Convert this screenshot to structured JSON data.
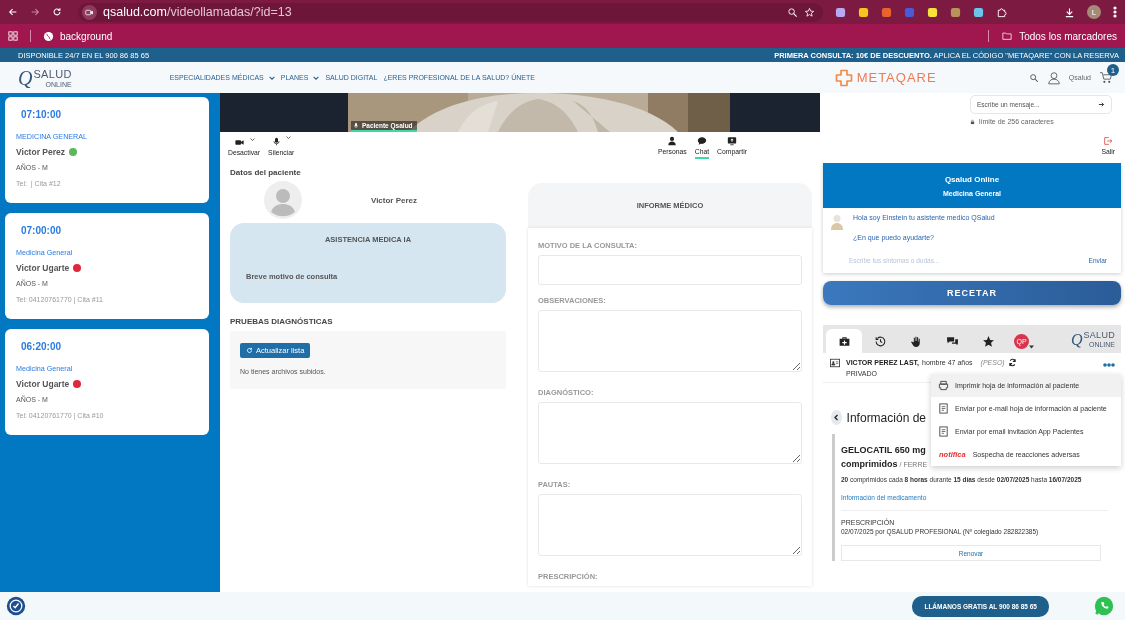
{
  "browser": {
    "url_host": "qsalud.com",
    "url_path": "/videollamadas/?id=13",
    "profile_initial": "L",
    "bookmark": "background",
    "all_bookmarks": "Todos los marcadores"
  },
  "promo": {
    "left": "DISPONIBLE 24/7 EN EL 900 86 85 65",
    "right": "**PRIMERA CONSULTA: 10€ DE DESCUENTO.** APLICA EL CÓDIGO \"METAQARE\" CON LA RESERVA"
  },
  "header": {
    "logo": {
      "mark": "Q",
      "name": "SALUD",
      "sub": "ONLINE"
    },
    "nav": [
      {
        "label": "ESPECIALIDADES MÉDICAS",
        "dropdown": true
      },
      {
        "label": "PLANES",
        "dropdown": true
      },
      {
        "label": "SALUD DIGITAL",
        "dropdown": false
      },
      {
        "label": "¿ERES PROFESIONAL DE LA SALUD? ÚNETE",
        "dropdown": false
      }
    ],
    "brand": "METAQARE",
    "user": "Qsalud",
    "cart_count": "1"
  },
  "appointments": [
    {
      "time": "07:10:00",
      "specialty": "MEDICINA GENERAL",
      "patient": "Victor Perez",
      "color": "#5cb85c",
      "age": "AÑOS - M",
      "contact": "Tel:  | Cita #12"
    },
    {
      "time": "07:00:00",
      "specialty": "Medicina General",
      "patient": "Victor Ugarte",
      "color": "#e0283c",
      "age": "AÑOS - M",
      "contact": "Tel: 04120761770 | Cita #11"
    },
    {
      "time": "06:20:00",
      "specialty": "Medicina General",
      "patient": "Victor Ugarte",
      "color": "#e0283c",
      "age": "AÑOS - M",
      "contact": "Tel: 04120761770 | Cita #10"
    }
  ],
  "video": {
    "participant": "Paciente Qsalud"
  },
  "message": {
    "placeholder": "Escribe un mensaje...",
    "limit": "límite de 256 caracteres"
  },
  "controls": [
    {
      "label": "Desactivar",
      "kind": "camera"
    },
    {
      "label": "Silenciar",
      "kind": "mic"
    }
  ],
  "views": [
    {
      "label": "Personas",
      "kind": "people",
      "selected": false
    },
    {
      "label": "Chat",
      "kind": "chat",
      "selected": true
    },
    {
      "label": "Compartir",
      "kind": "share",
      "selected": false
    }
  ],
  "exit": "Salir",
  "patient": {
    "heading": "Datos del paciente",
    "name": "Victor Perez"
  },
  "ai": {
    "title": "ASISTENCIA MEDICA IA",
    "reason": "Breve motivo de consulta"
  },
  "tests": {
    "heading": "PRUEBAS DIAGNÓSTICAS",
    "button": "Actualizar lista",
    "empty": "No tienes archivos subidos."
  },
  "report": {
    "title": "INFORME MÉDICO",
    "fields": [
      {
        "label": "MOTIVO DE LA CONSULTA:",
        "kind": "line"
      },
      {
        "label": "OBSERVACIONES:",
        "kind": "area"
      },
      {
        "label": "DIAGNÓSTICO:",
        "kind": "area"
      },
      {
        "label": "PAUTAS:",
        "kind": "area"
      },
      {
        "label": "PRESCRIPCIÓN:",
        "kind": "label"
      }
    ]
  },
  "assistant": {
    "title": "Qsalud Online",
    "subtitle": "Medicina General",
    "messages": [
      "Hola soy Einstein tu asistente medico QSalud",
      "¿En que puedo ayudarte?"
    ],
    "placeholder": "Escribe tus sintomas o dudas...",
    "send": "Enviar"
  },
  "prescribe": "RECETAR",
  "rx": {
    "tabs": [
      {
        "kind": "medkit",
        "selected": true
      },
      {
        "kind": "history",
        "selected": false
      },
      {
        "kind": "hand",
        "selected": false
      },
      {
        "kind": "chat",
        "selected": false
      },
      {
        "kind": "star",
        "selected": false
      },
      {
        "kind": "qp",
        "selected": false
      }
    ],
    "qp": "QP",
    "logo": {
      "mark": "Q",
      "name": "SALUD",
      "sub": "ONLINE"
    },
    "patient_name": "VICTOR PEREZ LAST,",
    "patient_info": "hombre 47 años",
    "weight": "(PESO)",
    "coverage": "PRIVADO",
    "section": "Información de",
    "drug_name": "GELOCATIL 650 mg",
    "drug_form": "comprimidos",
    "drug_lab": "/ FERRE",
    "dosage": "**20** comprimidos cada **8 horas** durante **15 días** desde **02/07/2025** hasta **16/07/2025**",
    "drug_link": "Información del medicamento",
    "rx_label": "PRESCRIPCIÓN",
    "rx_detail": "02/07/2025 por QSALUD PROFESIONAL (Nº colegiado 282822385)",
    "renew": "Renovar"
  },
  "menu": [
    {
      "label": "Imprimir hoja de información al paciente",
      "kind": "print",
      "selected": true
    },
    {
      "label": "Enviar por e-mail hoja de información al paciente",
      "kind": "doc",
      "selected": false
    },
    {
      "label": "Enviar por email invitación App Pacientes",
      "kind": "doc",
      "selected": false
    },
    {
      "label": "Sospecha de reacciones adversas",
      "kind": "notifica",
      "selected": false
    }
  ],
  "menu_logo": "notifica",
  "footer": {
    "call": "LLÁMANOS GRATIS AL 900 86 85 65"
  }
}
